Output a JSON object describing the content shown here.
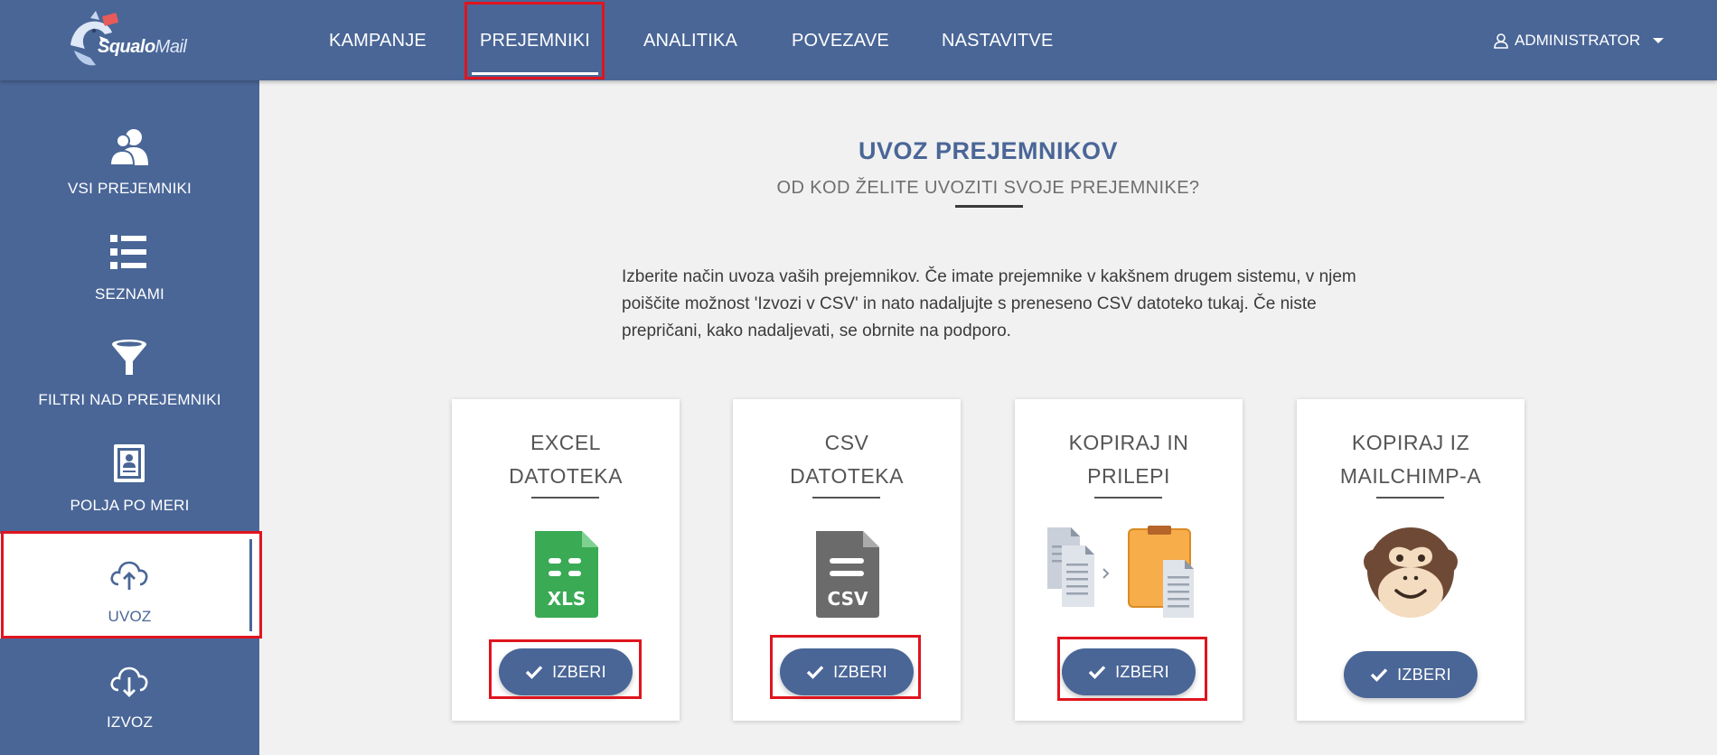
{
  "logo": {
    "brand": "Squalo",
    "suffix": "Mail"
  },
  "nav": {
    "items": [
      {
        "label": "KAMPANJE"
      },
      {
        "label": "PREJEMNIKI"
      },
      {
        "label": "ANALITIKA"
      },
      {
        "label": "POVEZAVE"
      },
      {
        "label": "NASTAVITVE"
      }
    ],
    "active": "PREJEMNIKI",
    "user_label": "ADMINISTRATOR"
  },
  "sidebar": {
    "items": [
      {
        "label": "VSI PREJEMNIKI",
        "icon": "users-icon"
      },
      {
        "label": "SEZNAMI",
        "icon": "list-icon"
      },
      {
        "label": "FILTRI NAD PREJEMNIKI",
        "icon": "filter-icon"
      },
      {
        "label": "POLJA PO MERI",
        "icon": "custom-fields-icon"
      },
      {
        "label": "UVOZ",
        "icon": "cloud-upload-icon"
      },
      {
        "label": "IZVOZ",
        "icon": "cloud-download-icon"
      }
    ],
    "active": "UVOZ"
  },
  "main": {
    "title": "UVOZ PREJEMNIKOV",
    "subtitle": "OD KOD ŽELITE UVOZITI SVOJE PREJEMNIKE?",
    "intro": "Izberite način uvoza vaših prejemnikov. Če imate prejemnike v kakšnem drugem sistemu, v njem poiščite možnost 'Izvozi v CSV' in nato nadaljujte s preneseno CSV datoteko tukaj. Če niste prepričani, kako nadaljevati, se obrnite na podporo."
  },
  "cards": [
    {
      "title_line1": "EXCEL",
      "title_line2": "DATOTEKA",
      "icon": "xls-file-icon",
      "file_label": "XLS",
      "button": "IZBERI"
    },
    {
      "title_line1": "CSV",
      "title_line2": "DATOTEKA",
      "icon": "csv-file-icon",
      "file_label": "CSV",
      "button": "IZBERI"
    },
    {
      "title_line1": "KOPIRAJ IN",
      "title_line2": "PRILEPI",
      "icon": "copy-paste-icon",
      "button": "IZBERI"
    },
    {
      "title_line1": "KOPIRAJ IZ",
      "title_line2": "MAILCHIMP-A",
      "icon": "mailchimp-monkey-icon",
      "button": "IZBERI"
    }
  ],
  "colors": {
    "primary": "#4a6697",
    "background": "#f1f1f1",
    "excel_green": "#3aaa55",
    "csv_grey": "#6b6b6b",
    "clipboard_orange": "#f6ad4a",
    "highlight_red": "#e0141e"
  }
}
